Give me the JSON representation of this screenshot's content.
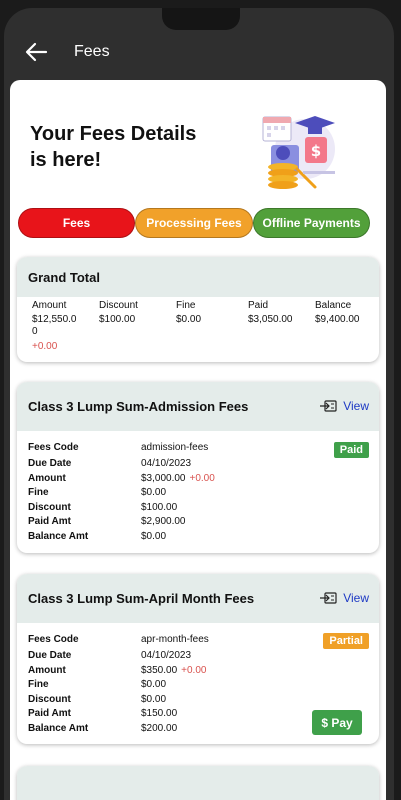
{
  "appbar": {
    "title": "Fees"
  },
  "hero": {
    "title_line1": "Your Fees Details",
    "title_line2": "is here!"
  },
  "tabs": [
    {
      "label": "Fees"
    },
    {
      "label": "Processing Fees"
    },
    {
      "label": "Offline Payments"
    }
  ],
  "grand_total": {
    "title": "Grand Total",
    "amount": {
      "label": "Amount",
      "value": "$12,550.0\n0",
      "extra": "+0.00"
    },
    "discount": {
      "label": "Discount",
      "value": "$100.00"
    },
    "fine": {
      "label": "Fine",
      "value": "$0.00"
    },
    "paid": {
      "label": "Paid",
      "value": "$3,050.00"
    },
    "balance": {
      "label": "Balance",
      "value": "$9,400.00"
    }
  },
  "fees": [
    {
      "title": "Class 3 Lump Sum-Admission Fees",
      "view_label": "View",
      "status": "Paid",
      "rows": {
        "code_label": "Fees Code",
        "code": "admission-fees",
        "due_label": "Due Date",
        "due": "04/10/2023",
        "amount_label": "Amount",
        "amount": "$3,000.00",
        "amount_extra": "+0.00",
        "fine_label": "Fine",
        "fine": "$0.00",
        "discount_label": "Discount",
        "discount": "$100.00",
        "paid_label": "Paid Amt",
        "paid": "$2,900.00",
        "balance_label": "Balance Amt",
        "balance": "$0.00"
      }
    },
    {
      "title": "Class 3 Lump Sum-April Month Fees",
      "view_label": "View",
      "status": "Partial",
      "pay_label": "$ Pay",
      "rows": {
        "code_label": "Fees Code",
        "code": "apr-month-fees",
        "due_label": "Due Date",
        "due": "04/10/2023",
        "amount_label": "Amount",
        "amount": "$350.00",
        "amount_extra": "+0.00",
        "fine_label": "Fine",
        "fine": "$0.00",
        "discount_label": "Discount",
        "discount": "$0.00",
        "paid_label": "Paid Amt",
        "paid": "$150.00",
        "balance_label": "Balance Amt",
        "balance": "$200.00"
      }
    }
  ],
  "colors": {
    "fees_tab": "#e8141a",
    "processing_tab": "#f1a12a",
    "offline_tab": "#52a03a",
    "paid_badge": "#3fa04a",
    "partial_badge": "#f0a027",
    "link": "#1d39c4",
    "extra": "#d9534f"
  },
  "icons": {
    "back": "arrow-left-icon",
    "view": "receipt-arrow-icon",
    "illustration": "fees-illustration"
  }
}
